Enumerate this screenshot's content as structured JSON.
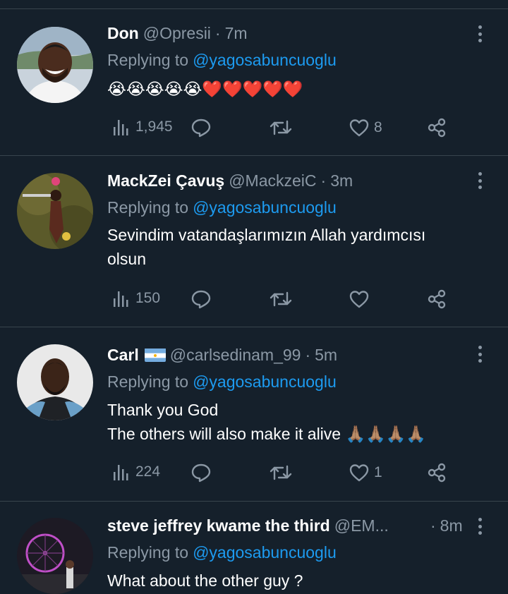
{
  "reply_prefix": "Replying to",
  "reply_handle": "@yagosabuncuoglu",
  "tweets": [
    {
      "name": "Don",
      "handle": "@Opresii",
      "separator": "·",
      "time": "7m",
      "body_lines": [
        "😭😭😭😭😭❤️❤️❤️❤️❤️"
      ],
      "views": "1,945",
      "replies": "",
      "retweets": "",
      "likes": "8"
    },
    {
      "name": "MackZei Çavuş",
      "handle": "@MackzeiC",
      "separator": "·",
      "time": "3m",
      "body_lines": [
        "Sevindim vatandaşlarımızın Allah yardımcısı",
        "olsun"
      ],
      "views": "150",
      "replies": "",
      "retweets": "",
      "likes": ""
    },
    {
      "name": "Carl",
      "flag": "argentina",
      "handle": "@carlsedinam_99",
      "separator": "·",
      "time": "5m",
      "body_lines": [
        "Thank you God",
        "The others will also make it alive 🙏🏽🙏🏽🙏🏽🙏🏽"
      ],
      "views": "224",
      "replies": "",
      "retweets": "",
      "likes": "1"
    },
    {
      "name": "steve jeffrey kwame the third",
      "handle": "@EM...",
      "separator": "·",
      "time": "8m",
      "body_lines": [
        "What about the other guy ?"
      ]
    }
  ],
  "icons": {
    "views": "bar-chart-icon",
    "reply": "speech-bubble-icon",
    "retweet": "retweet-icon",
    "like": "heart-icon",
    "share": "share-icon",
    "more": "more-vertical-icon"
  },
  "colors": {
    "background": "#15202b",
    "divider": "#38444d",
    "secondary_text": "#8b98a5",
    "link": "#1d9bf0"
  }
}
